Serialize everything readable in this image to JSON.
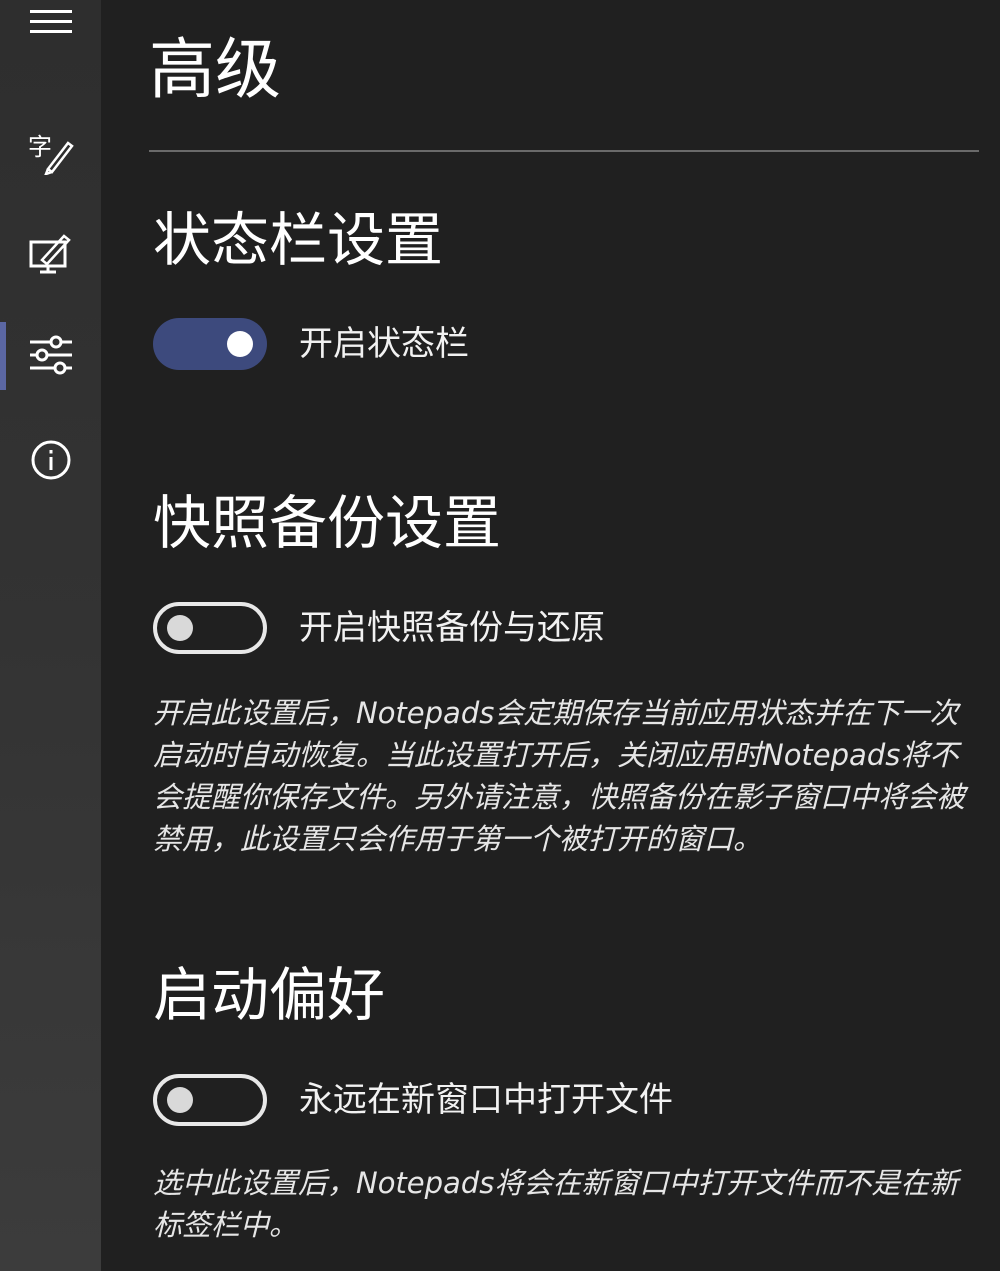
{
  "page": {
    "title": "高级"
  },
  "sidebar": {
    "menu_icon": "hamburger-menu-icon",
    "items": [
      {
        "icon": "text-font-icon",
        "selected": false
      },
      {
        "icon": "personalization-icon",
        "selected": false
      },
      {
        "icon": "sliders-settings-icon",
        "selected": true
      },
      {
        "icon": "info-icon",
        "selected": false
      }
    ]
  },
  "sections": {
    "status_bar": {
      "title": "状态栏设置",
      "toggle_label": "开启状态栏",
      "toggle_on": true
    },
    "snapshot": {
      "title": "快照备份设置",
      "toggle_label": "开启快照备份与还原",
      "toggle_on": false,
      "description": "开启此设置后，Notepads会定期保存当前应用状态并在下一次启动时自动恢复。当此设置打开后，关闭应用时Notepads将不会提醒你保存文件。另外请注意，快照备份在影子窗口中将会被禁用，此设置只会作用于第一个被打开的窗口。"
    },
    "launch": {
      "title": "启动偏好",
      "toggle_label": "永远在新窗口中打开文件",
      "toggle_on": false,
      "description": "选中此设置后，Notepads将会在新窗口中打开文件而不是在新标签栏中。"
    }
  },
  "colors": {
    "background": "#202020",
    "sidebar": "#333333",
    "accent": "#3d4a7d",
    "selection_indicator": "#5b67a3"
  }
}
